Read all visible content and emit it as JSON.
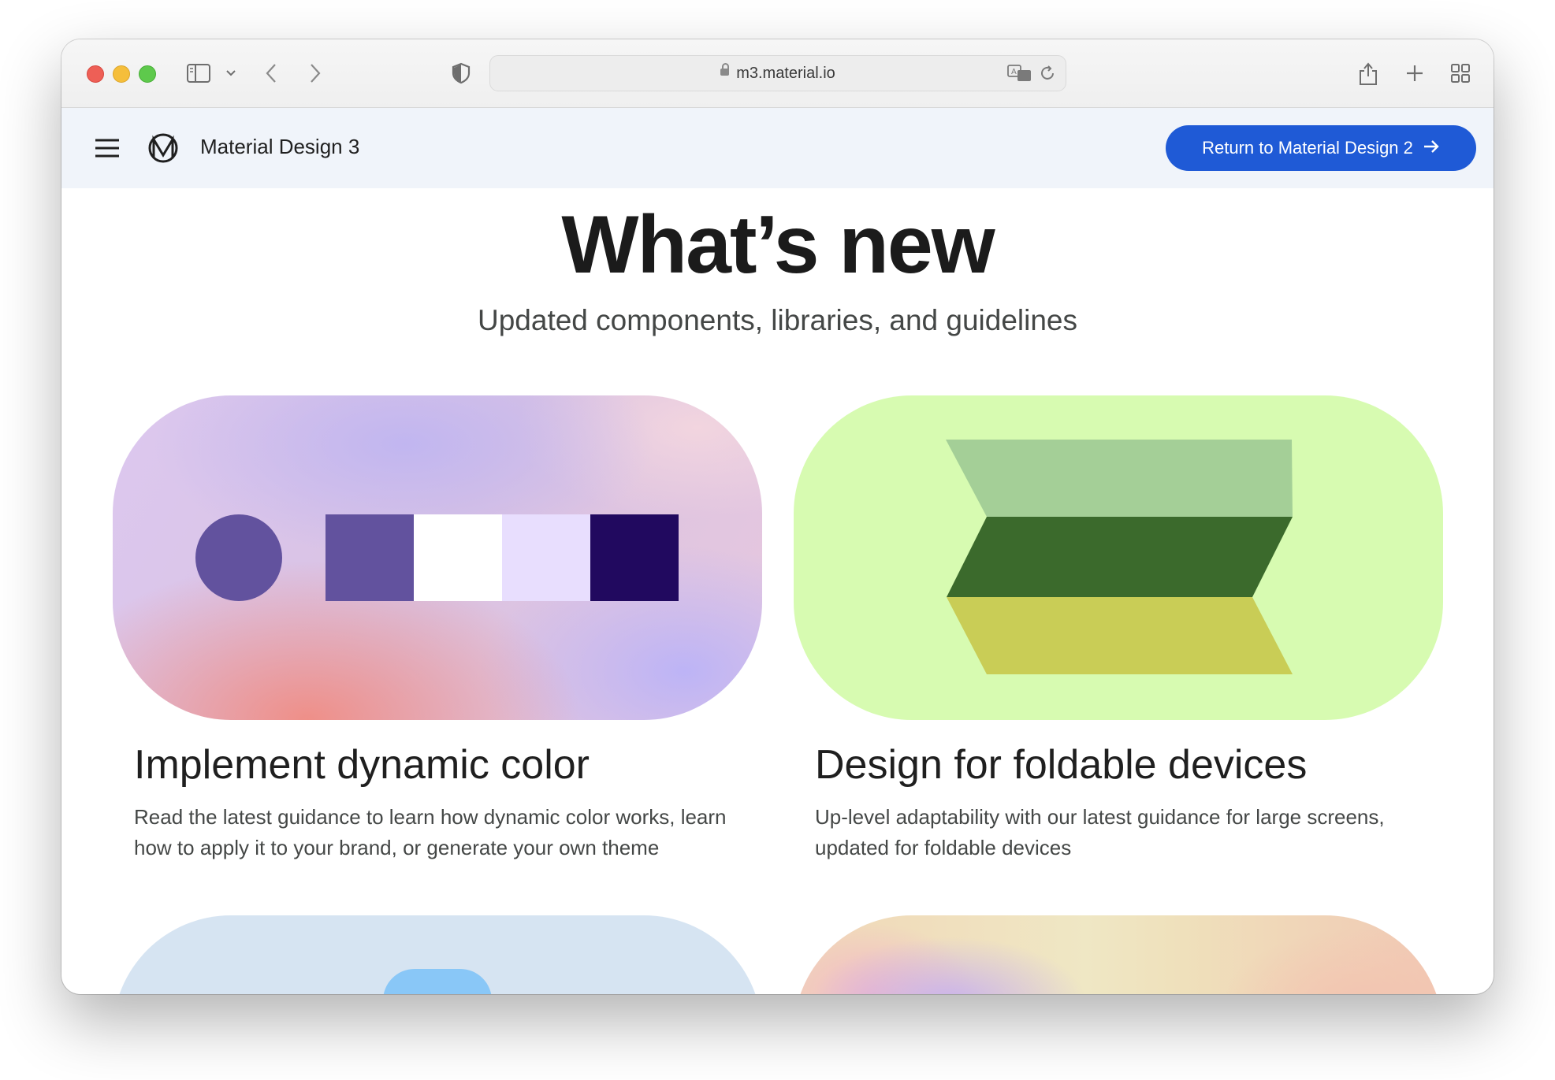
{
  "browser": {
    "url": "m3.material.io"
  },
  "appbar": {
    "title": "Material Design 3",
    "cta_label": "Return to Material Design 2"
  },
  "hero": {
    "title": "What’s new",
    "subtitle": "Updated components, libraries, and guidelines"
  },
  "cards": [
    {
      "title": "Implement dynamic color",
      "description": "Read the latest guidance to learn how dynamic color works, learn how to apply it to your brand, or generate your own theme",
      "swatch_colors": [
        "#62529e",
        "#62529e",
        "#ffffff",
        "#e8defe",
        "#21095f"
      ]
    },
    {
      "title": "Design for foldable devices",
      "description": "Up-level adaptability with our latest guidance for large screens, updated for foldable devices",
      "band_colors": [
        "#a4cf97",
        "#3b6a2c",
        "#c9cd56"
      ]
    }
  ],
  "colors": {
    "accent": "#1f5ad6",
    "appbar_bg": "#f0f4fa",
    "foldable_bg": "#d7fbb1"
  },
  "icons": {
    "menu": "menu-icon",
    "logo": "material-logo-icon",
    "arrow": "arrow-right-icon"
  }
}
